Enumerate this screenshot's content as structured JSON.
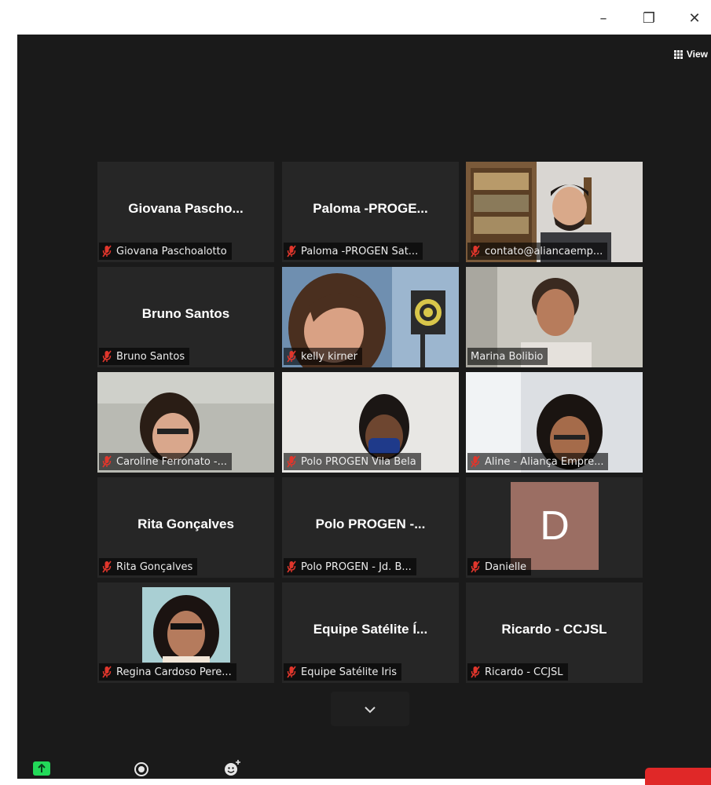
{
  "window": {
    "minimize": "–",
    "restore": "❐",
    "close": "✕"
  },
  "toolbar": {
    "view_label": "View"
  },
  "participants": [
    {
      "display": "Giovana Pascho...",
      "label": "Giovana Paschoalotto"
    },
    {
      "display": "Paloma -PROGE...",
      "label": "Paloma -PROGEN Sat..."
    },
    {
      "display": "",
      "label": "contato@aliancaemp..."
    },
    {
      "display": "Bruno Santos",
      "label": "Bruno Santos"
    },
    {
      "display": "",
      "label": "kelly kirner"
    },
    {
      "display": "",
      "label": "Marina Bolibio"
    },
    {
      "display": "",
      "label": "Caroline Ferronato -..."
    },
    {
      "display": "",
      "label": "Polo PROGEN Vila Bela"
    },
    {
      "display": "",
      "label": "Aline - Aliança Empre..."
    },
    {
      "display": "Rita Gonçalves",
      "label": "Rita Gonçalves"
    },
    {
      "display": "Polo PROGEN -...",
      "label": "Polo PROGEN - Jd. B..."
    },
    {
      "display": "",
      "label": "Danielle",
      "avatar_letter": "D"
    },
    {
      "display": "",
      "label": "Regina Cardoso Pere..."
    },
    {
      "display": "Equipe Satélite Í...",
      "label": "Equipe Satélite Íris"
    },
    {
      "display": "Ricardo - CCJSL",
      "label": "Ricardo - CCJSL"
    }
  ],
  "colors": {
    "app_bg": "#1a1a1a",
    "tile_bg": "#262626",
    "active_speaker": "#cfe36a",
    "muted_icon": "#e0362c",
    "share": "#23d959",
    "end": "#e02828",
    "avatar_d": "#9b6e63"
  }
}
